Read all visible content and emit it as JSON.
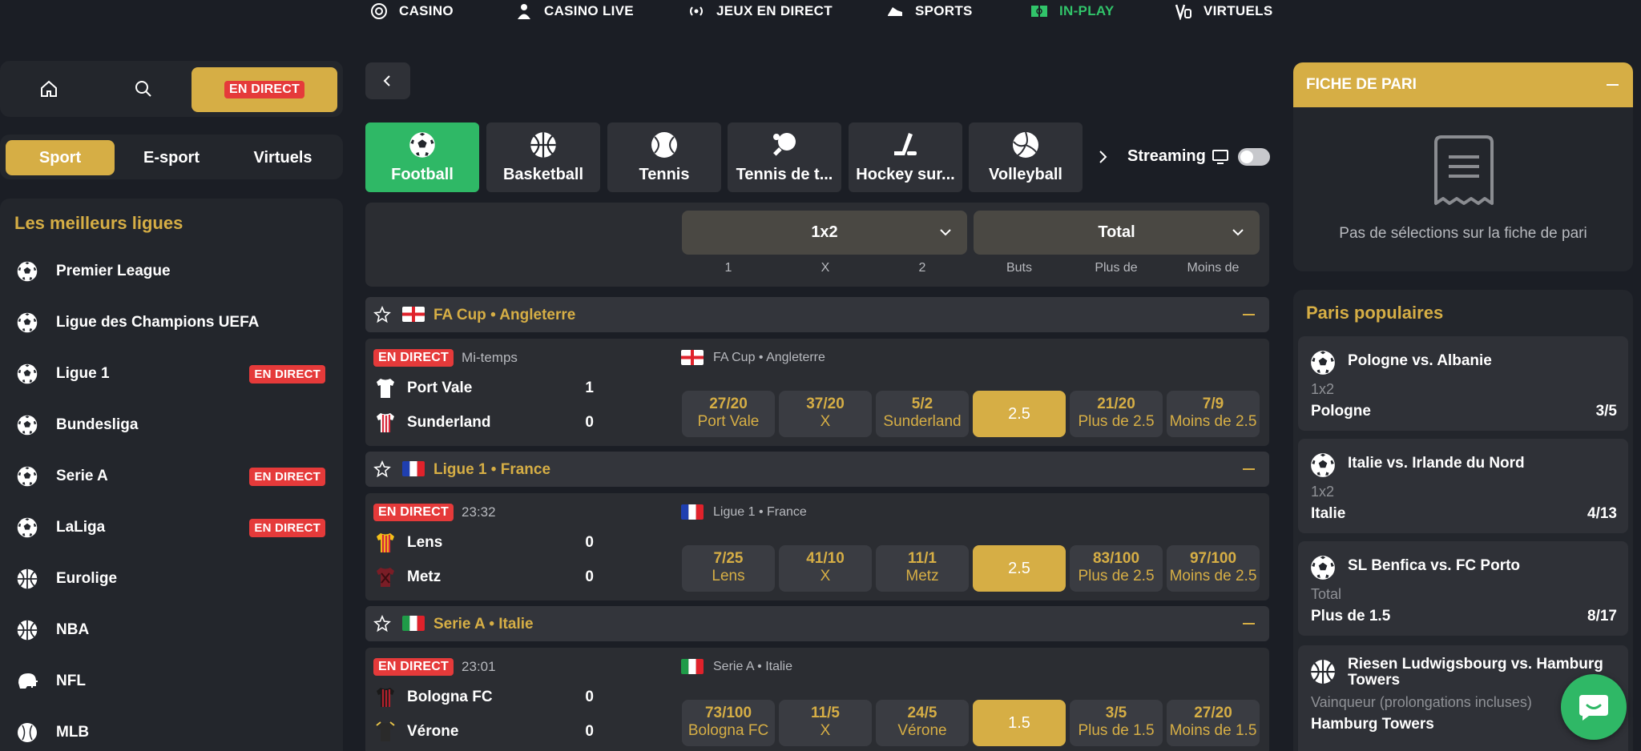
{
  "topnav": {
    "items": [
      {
        "label": "CASINO",
        "icon": "casino-chip-icon"
      },
      {
        "label": "CASINO LIVE",
        "icon": "dealer-icon"
      },
      {
        "label": "JEUX EN DIRECT",
        "icon": "broadcast-icon"
      },
      {
        "label": "SPORTS",
        "icon": "sports-shoe-icon"
      },
      {
        "label": "IN-PLAY",
        "icon": "pitch-icon"
      },
      {
        "label": "VIRTUELS",
        "icon": "virtual-icon"
      }
    ],
    "active_color": "#31c46a"
  },
  "left": {
    "home_icon": "home-icon",
    "search_icon": "search-icon",
    "live_label": "EN DIRECT",
    "tabs": [
      "Sport",
      "E-sport",
      "Virtuels"
    ],
    "leagues_title": "Les meilleurs ligues",
    "leagues": [
      {
        "name": "Premier League",
        "icon": "football-icon",
        "live": ""
      },
      {
        "name": "Ligue des Champions UEFA",
        "icon": "football-icon",
        "live": ""
      },
      {
        "name": "Ligue 1",
        "icon": "football-icon",
        "live": "EN DIRECT"
      },
      {
        "name": "Bundesliga",
        "icon": "football-icon",
        "live": ""
      },
      {
        "name": "Serie A",
        "icon": "football-icon",
        "live": "EN DIRECT"
      },
      {
        "name": "LaLiga",
        "icon": "football-icon",
        "live": "EN DIRECT"
      },
      {
        "name": "Eurolige",
        "icon": "basketball-icon",
        "live": ""
      },
      {
        "name": "NBA",
        "icon": "basketball-icon",
        "live": ""
      },
      {
        "name": "NFL",
        "icon": "helmet-icon",
        "live": ""
      },
      {
        "name": "MLB",
        "icon": "baseball-icon",
        "live": ""
      }
    ]
  },
  "main": {
    "back_icon": "chevron-left-icon",
    "sports": [
      "Football",
      "Basketball",
      "Tennis",
      "Tennis de t...",
      "Hockey sur...",
      "Volleyball"
    ],
    "streaming_label": "Streaming",
    "markets": [
      {
        "label": "1x2",
        "cols": [
          "1",
          "X",
          "2"
        ]
      },
      {
        "label": "Total",
        "cols": [
          "Buts",
          "Plus de",
          "Moins de"
        ]
      }
    ],
    "events": [
      {
        "league": "FA Cup • Angleterre",
        "flag": "england",
        "status": "EN DIRECT",
        "time": "Mi-temps",
        "home": "Port Vale",
        "away": "Sunderland",
        "home_score": "1",
        "away_score": "0",
        "odds": [
          {
            "v": "27/20",
            "l": "Port Vale"
          },
          {
            "v": "37/20",
            "l": "X"
          },
          {
            "v": "5/2",
            "l": "Sunderland"
          },
          {
            "v": "2.5",
            "l": ""
          },
          {
            "v": "21/20",
            "l": "Plus de 2.5"
          },
          {
            "v": "7/9",
            "l": "Moins de 2.5"
          }
        ]
      },
      {
        "league": "Ligue 1 • France",
        "flag": "france",
        "status": "EN DIRECT",
        "time": "23:32",
        "home": "Lens",
        "away": "Metz",
        "home_score": "0",
        "away_score": "0",
        "odds": [
          {
            "v": "7/25",
            "l": "Lens"
          },
          {
            "v": "41/10",
            "l": "X"
          },
          {
            "v": "11/1",
            "l": "Metz"
          },
          {
            "v": "2.5",
            "l": ""
          },
          {
            "v": "83/100",
            "l": "Plus de 2.5"
          },
          {
            "v": "97/100",
            "l": "Moins de 2.5"
          }
        ]
      },
      {
        "league": "Serie A • Italie",
        "flag": "italy",
        "status": "EN DIRECT",
        "time": "23:01",
        "home": "Bologna FC",
        "away": "Vérone",
        "home_score": "0",
        "away_score": "0",
        "odds": [
          {
            "v": "73/100",
            "l": "Bologna FC"
          },
          {
            "v": "11/5",
            "l": "X"
          },
          {
            "v": "24/5",
            "l": "Vérone"
          },
          {
            "v": "1.5",
            "l": ""
          },
          {
            "v": "3/5",
            "l": "Plus de 1.5"
          },
          {
            "v": "27/20",
            "l": "Moins de 1.5"
          }
        ]
      }
    ]
  },
  "right": {
    "betslip_title": "FICHE DE PARI",
    "betslip_empty": "Pas de sélections sur la fiche de pari",
    "popular_title": "Paris populaires",
    "popular": [
      {
        "title": "Pologne vs. Albanie",
        "market": "1x2",
        "selection": "Pologne",
        "price": "3/5",
        "icon": "football-icon"
      },
      {
        "title": "Italie vs. Irlande du Nord",
        "market": "1x2",
        "selection": "Italie",
        "price": "4/13",
        "icon": "football-icon"
      },
      {
        "title": "SL Benfica vs. FC Porto",
        "market": "Total",
        "selection": "Plus de 1.5",
        "price": "8/17",
        "icon": "football-icon"
      },
      {
        "title": "Riesen Ludwigsbourg vs. Hamburg Towers",
        "market": "Vainqueur (prolongations incluses)",
        "selection": "Hamburg Towers",
        "price": "",
        "icon": "basketball-icon"
      }
    ]
  },
  "colors": {
    "gold": "#d6ae45",
    "green": "#2fb866",
    "live": "#e53a3a",
    "bg": "#1b1e25",
    "panel": "#23262c"
  }
}
